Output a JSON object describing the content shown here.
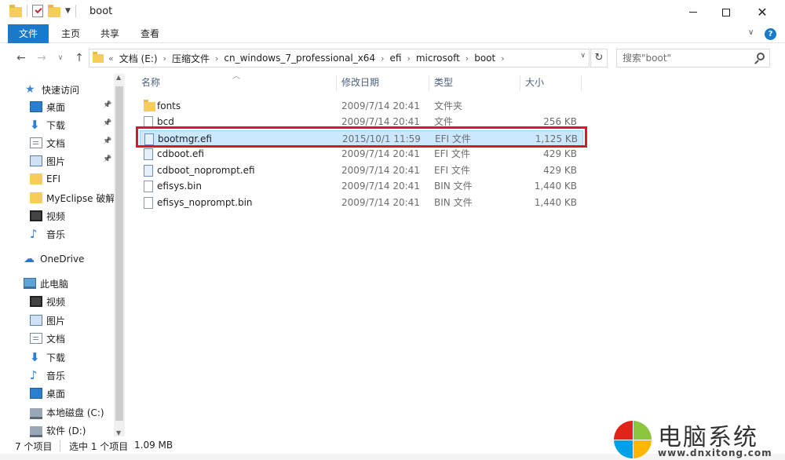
{
  "window": {
    "title": "boot",
    "controls": {
      "minimize": "─",
      "maximize": "☐",
      "close": "✕"
    }
  },
  "ribbon": {
    "tabs": [
      "文件",
      "主页",
      "共享",
      "查看"
    ],
    "help": "?"
  },
  "address_bar": {
    "prefix": "«",
    "breadcrumbs": [
      "文档 (E:)",
      "压缩文件",
      "cn_windows_7_professional_x64",
      "efi",
      "microsoft",
      "boot"
    ],
    "search_placeholder": "搜索\"boot\""
  },
  "nav_pane": {
    "items": [
      {
        "label": "快速访问",
        "icon": "star-icon",
        "pinned": false
      },
      {
        "label": "桌面",
        "icon": "desktop-icon",
        "pinned": true
      },
      {
        "label": "下载",
        "icon": "download-icon",
        "pinned": true
      },
      {
        "label": "文档",
        "icon": "document-icon",
        "pinned": true
      },
      {
        "label": "图片",
        "icon": "picture-icon",
        "pinned": true
      },
      {
        "label": "EFI",
        "icon": "folder-icon",
        "pinned": false
      },
      {
        "label": "MyEclipse 破解",
        "icon": "folder-icon",
        "pinned": false
      },
      {
        "label": "视频",
        "icon": "video-icon",
        "pinned": false
      },
      {
        "label": "音乐",
        "icon": "music-icon",
        "pinned": false
      },
      {
        "label": "OneDrive",
        "icon": "cloud-icon",
        "pinned": false
      },
      {
        "label": "此电脑",
        "icon": "computer-icon",
        "pinned": false
      },
      {
        "label": "视频",
        "icon": "video-icon",
        "pinned": false
      },
      {
        "label": "图片",
        "icon": "picture-icon",
        "pinned": false
      },
      {
        "label": "文档",
        "icon": "document-icon",
        "pinned": false
      },
      {
        "label": "下载",
        "icon": "download-icon",
        "pinned": false
      },
      {
        "label": "音乐",
        "icon": "music-icon",
        "pinned": false
      },
      {
        "label": "桌面",
        "icon": "desktop-icon",
        "pinned": false
      },
      {
        "label": "本地磁盘 (C:)",
        "icon": "drive-icon",
        "pinned": false
      },
      {
        "label": "软件 (D:)",
        "icon": "drive-icon",
        "pinned": false
      }
    ]
  },
  "file_list": {
    "columns": [
      "名称",
      "修改日期",
      "类型",
      "大小"
    ],
    "rows": [
      {
        "name": "fonts",
        "date": "2009/7/14 20:41",
        "type": "文件夹",
        "size": "",
        "icon": "folder-icon",
        "selected": false
      },
      {
        "name": "bcd",
        "date": "2009/7/14 20:41",
        "type": "文件",
        "size": "256 KB",
        "icon": "file-icon",
        "selected": false
      },
      {
        "name": "bootmgr.efi",
        "date": "2015/10/1 11:59",
        "type": "EFI 文件",
        "size": "1,125 KB",
        "icon": "efi-file-icon",
        "selected": true
      },
      {
        "name": "cdboot.efi",
        "date": "2009/7/14 20:41",
        "type": "EFI 文件",
        "size": "429 KB",
        "icon": "efi-file-icon",
        "selected": false
      },
      {
        "name": "cdboot_noprompt.efi",
        "date": "2009/7/14 20:41",
        "type": "EFI 文件",
        "size": "429 KB",
        "icon": "efi-file-icon",
        "selected": false
      },
      {
        "name": "efisys.bin",
        "date": "2009/7/14 20:41",
        "type": "BIN 文件",
        "size": "1,440 KB",
        "icon": "file-icon",
        "selected": false
      },
      {
        "name": "efisys_noprompt.bin",
        "date": "2009/7/14 20:41",
        "type": "BIN 文件",
        "size": "1,440 KB",
        "icon": "file-icon",
        "selected": false
      }
    ]
  },
  "status_bar": {
    "item_count": "7 个项目",
    "selection": "选中 1 个项目",
    "selection_size": "1.09 MB"
  },
  "watermark": {
    "title": "电脑系统",
    "url": "www.dnxitong.com",
    "colors": [
      "#e2231a",
      "#8cc63f",
      "#00a0e9",
      "#ffb600"
    ]
  },
  "colors": {
    "accent": "#1979ca",
    "selection_bg": "#cce8ff",
    "highlight_border": "#d9192b"
  }
}
